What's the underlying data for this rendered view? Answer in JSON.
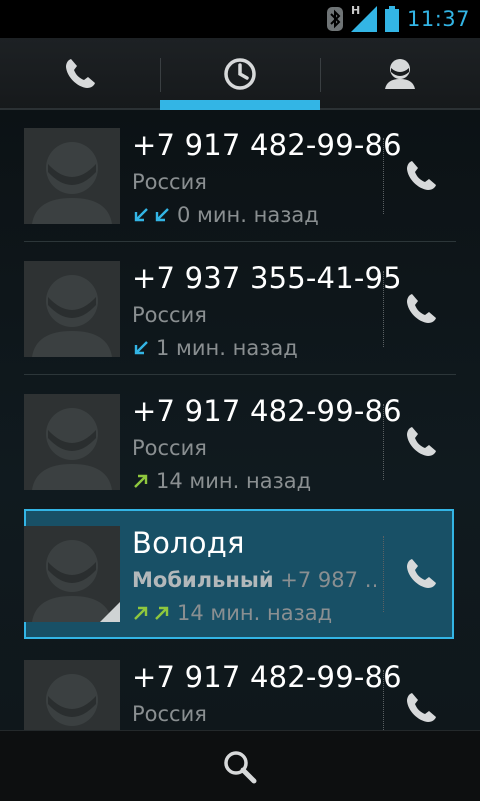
{
  "status_bar": {
    "time": "11:37",
    "network_type": "H",
    "icons": [
      "bluetooth-icon",
      "signal-icon",
      "battery-icon"
    ],
    "accent_color": "#33b5e5"
  },
  "tabs": [
    {
      "name": "phone",
      "icon": "phone-icon",
      "selected": false
    },
    {
      "name": "call-log",
      "icon": "clock-icon",
      "selected": true
    },
    {
      "name": "contacts",
      "icon": "person-icon",
      "selected": false
    }
  ],
  "calls": [
    {
      "name": "+7 917 482-99-86",
      "label": "",
      "detail": "Россия",
      "direction": "incoming",
      "arrows": 2,
      "time": "0 мин. назад",
      "selected": false
    },
    {
      "name": "+7 937 355-41-95",
      "label": "",
      "detail": "Россия",
      "direction": "incoming",
      "arrows": 1,
      "time": "1 мин. назад",
      "selected": false
    },
    {
      "name": "+7 917 482-99-86",
      "label": "",
      "detail": "Россия",
      "direction": "outgoing",
      "arrows": 1,
      "time": "14 мин. назад",
      "selected": false
    },
    {
      "name": "Володя",
      "label": "Мобильный",
      "detail": "+7 987 …",
      "direction": "outgoing",
      "arrows": 2,
      "time": "14 мин. назад",
      "selected": true
    },
    {
      "name": "+7 917 482-99-86",
      "label": "",
      "detail": "Россия",
      "direction": "",
      "arrows": 0,
      "time": "",
      "selected": false
    }
  ],
  "colors": {
    "incoming": "#33b5e5",
    "outgoing": "#8fc73e",
    "selected_bg": "#185066"
  },
  "bottom_bar": {
    "icon": "search-icon"
  }
}
